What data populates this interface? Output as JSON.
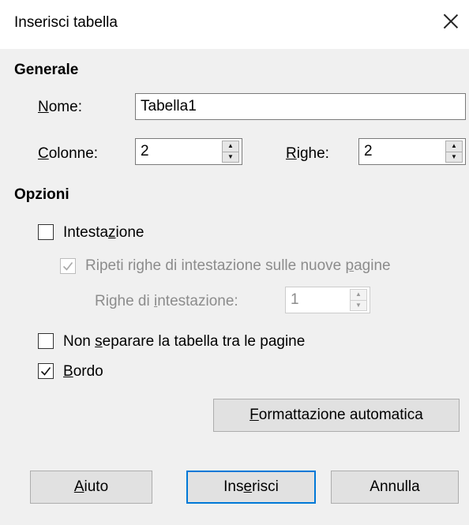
{
  "dialog": {
    "title": "Inserisci tabella",
    "close_symbol": "✕"
  },
  "generale": {
    "section_title": "Generale",
    "nome_label": {
      "before": "",
      "key": "N",
      "after": "ome:"
    },
    "nome_value": "Tabella1",
    "colonne_label": {
      "before": "",
      "key": "C",
      "after": "olonne:"
    },
    "colonne_value": "2",
    "righe_label": {
      "before": "",
      "key": "R",
      "after": "ighe:"
    },
    "righe_value": "2"
  },
  "opzioni": {
    "section_title": "Opzioni",
    "intestazione": {
      "before": "Intesta",
      "key": "z",
      "after": "ione",
      "checked": false
    },
    "ripeti": {
      "before": "Ripeti righe di intestazione sulle nuove ",
      "key": "p",
      "after": "agine",
      "checked": true,
      "enabled": false
    },
    "righe_intestazione_label": {
      "before": "Righe di ",
      "key": "i",
      "after": "ntestazione:"
    },
    "righe_intestazione_value": "1",
    "non_separare": {
      "before": "Non ",
      "key": "s",
      "after": "eparare la tabella tra le pagine",
      "checked": false
    },
    "bordo": {
      "before": "",
      "key": "B",
      "after": "ordo",
      "checked": true
    }
  },
  "buttons": {
    "formattazione": {
      "before": "",
      "key": "F",
      "after": "ormattazione automatica"
    },
    "aiuto": {
      "before": "",
      "key": "A",
      "after": "iuto"
    },
    "inserisci": {
      "before": "Ins",
      "key": "e",
      "after": "risci"
    },
    "annulla": {
      "before": "Annulla",
      "key": "",
      "after": ""
    }
  },
  "icons": {
    "spin_up": "▲",
    "spin_down": "▼"
  },
  "colors": {
    "accent": "#0078d7",
    "panel_bg": "#f0f0f0",
    "disabled_text": "#8c8c8c"
  }
}
